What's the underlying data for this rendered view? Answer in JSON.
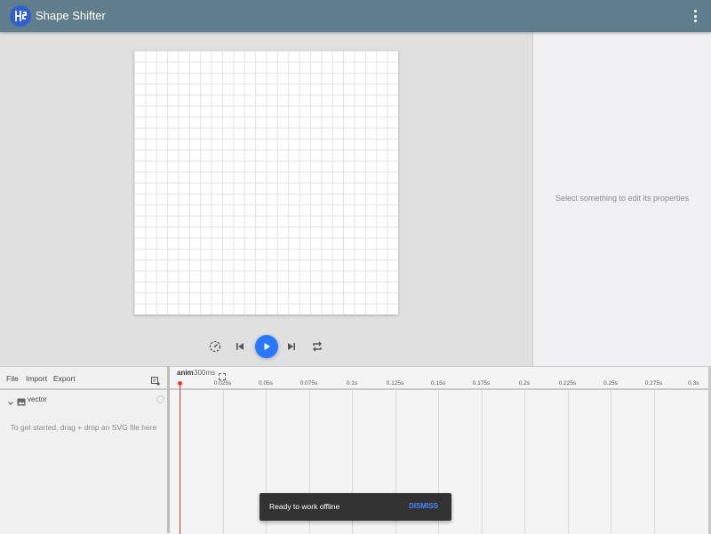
{
  "app": {
    "title": "Shape Shifter",
    "logo_icon": "shape-shifter-logo",
    "menu_icon": "more-vert-icon",
    "bar_color": "#607d8b"
  },
  "player": {
    "controls": [
      "playback-speed-icon",
      "skip-previous-icon",
      "play-icon",
      "skip-next-icon",
      "repeat-icon"
    ],
    "play_color": "#2979ff"
  },
  "properties": {
    "hint": "Select something to edit its properties"
  },
  "layers": {
    "toolbar": {
      "file": "File",
      "import": "Import",
      "export": "Export",
      "add_icon": "add-layer-icon"
    },
    "root_layer": {
      "name": "vector",
      "icon": "image-icon"
    },
    "empty_hint": "To get started, drag + drop an SVG file here"
  },
  "timeline": {
    "animation_name": "anim",
    "duration": "300ms",
    "ticks": [
      "0.025s",
      "0.05s",
      "0.075s",
      "0.1s",
      "0.125s",
      "0.15s",
      "0.175s",
      "0.2s",
      "0.225s",
      "0.25s",
      "0.275s",
      "0.3s"
    ],
    "playhead_color": "#e53935"
  },
  "snackbar": {
    "message": "Ready to work offline",
    "action": "DISMISS"
  }
}
